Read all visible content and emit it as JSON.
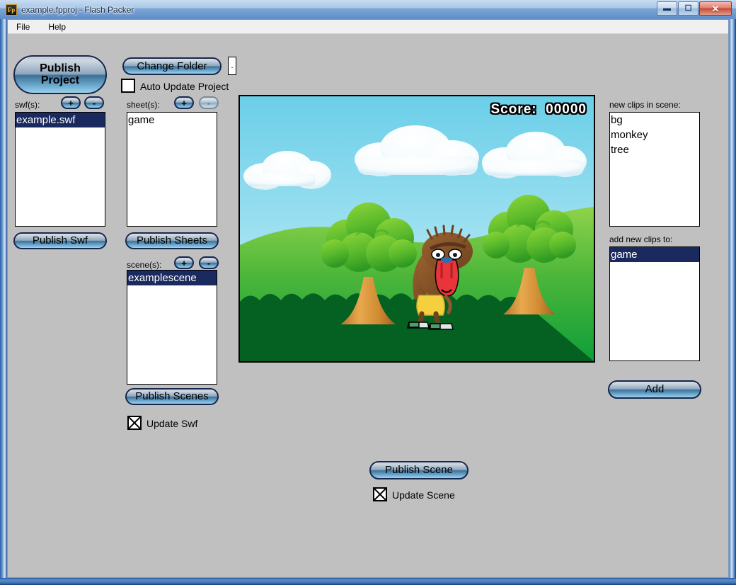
{
  "window": {
    "title": "example.fpproj - Flash Packer",
    "app_icon": "Fp",
    "buttons": {
      "minimize": "–",
      "maximize": "❐",
      "close": "✕"
    }
  },
  "menu": {
    "items": [
      {
        "label": "File"
      },
      {
        "label": "Help"
      }
    ]
  },
  "toolbar": {
    "publish_project_line1": "Publish",
    "publish_project_line2": "Project",
    "change_folder": "Change Folder",
    "folder_path_value": ".",
    "auto_update_project_label": "Auto Update Project",
    "auto_update_project_checked": false
  },
  "swf_panel": {
    "label": "swf(s):",
    "add_button": "+",
    "remove_button": "-",
    "items": [
      {
        "label": "example.swf",
        "selected": true
      }
    ],
    "publish_button": "Publish Swf"
  },
  "sheet_panel": {
    "label": "sheet(s):",
    "add_button": "+",
    "remove_button": "-",
    "remove_disabled": true,
    "items": [
      {
        "label": "game",
        "selected": false
      }
    ],
    "publish_button": "Publish Sheets"
  },
  "scene_panel": {
    "label": "scene(s):",
    "add_button": "+",
    "remove_button": "-",
    "items": [
      {
        "label": "examplescene",
        "selected": true
      }
    ],
    "publish_button": "Publish Scenes",
    "update_swf_label": "Update Swf",
    "update_swf_checked": true
  },
  "clips_panel": {
    "new_clips_label": "new clips in scene:",
    "new_clips": [
      {
        "label": "bg",
        "selected": false
      },
      {
        "label": "monkey",
        "selected": false
      },
      {
        "label": "tree",
        "selected": false
      }
    ],
    "add_new_clips_to_label": "add new clips to:",
    "targets": [
      {
        "label": "game",
        "selected": true
      }
    ],
    "add_button": "Add"
  },
  "bottom": {
    "publish_scene_button": "Publish Scene",
    "update_scene_label": "Update Scene",
    "update_scene_checked": true
  },
  "preview": {
    "score_label": "Score:",
    "score_value": "00000",
    "scene_name": "examplescene",
    "colors": {
      "sky_top": "#6bcfe8",
      "sky_bottom": "#cdeef7",
      "hill_light": "#7ac943",
      "hill_dark": "#0a9b3c",
      "bush_dark": "#046122",
      "trunk": "#d4903c",
      "leaf_light": "#7ec832",
      "leaf_dark": "#3ba92a",
      "monkey_fur": "#8a5a2b",
      "monkey_face": "#e8343a",
      "monkey_shorts": "#f4d03f"
    }
  },
  "theme": {
    "window_chrome": "#5f8cc8",
    "client_bg": "#c0c0c0",
    "selection_blue": "#1b2a5e",
    "button_border": "#16264d"
  }
}
